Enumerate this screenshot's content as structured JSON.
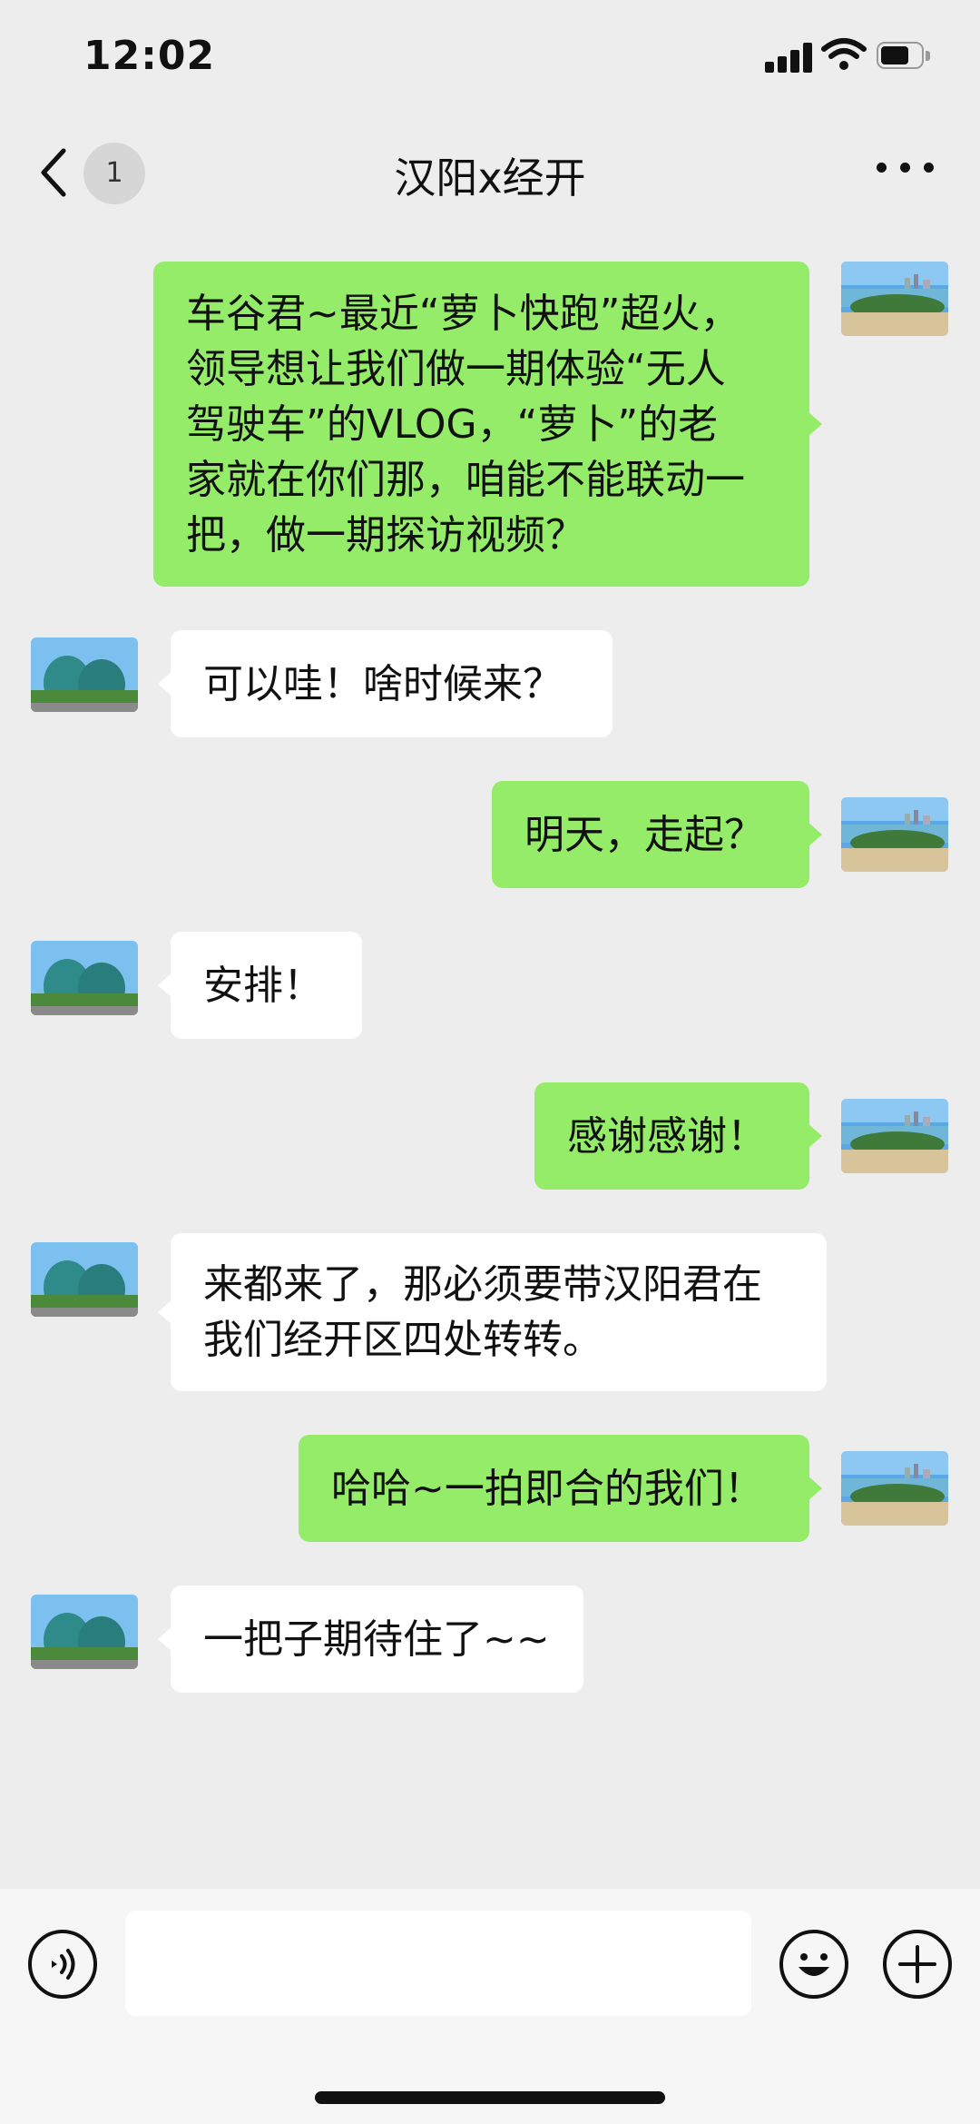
{
  "status_bar": {
    "time": "12:02"
  },
  "header": {
    "unread_count": "1",
    "title": "汉阳x经开"
  },
  "messages": [
    {
      "side": "out",
      "text": "车谷君~最近“萝卜快跑”超火，\n领导想让我们做一期体验“无人\n驾驶车”的VLOG，“萝卜”的老\n家就在你们那，咱能不能联动一\n把，做一期探访视频？"
    },
    {
      "side": "in",
      "text": "可以哇！啥时候来？"
    },
    {
      "side": "out",
      "text": "明天，走起？"
    },
    {
      "side": "in",
      "text": "安排！"
    },
    {
      "side": "out",
      "text": "感谢感谢！"
    },
    {
      "side": "in",
      "text": "来都来了，那必须要带汉阳君在\n我们经开区四处转转。"
    },
    {
      "side": "out",
      "text": "哈哈~一拍即合的我们！"
    },
    {
      "side": "in",
      "text": "一把子期待住了~~"
    }
  ],
  "input_bar": {
    "text_value": ""
  },
  "icons": {
    "back": "chevron-left-icon",
    "more": "more-dots-icon",
    "voice": "voice-icon",
    "emoji": "emoji-icon",
    "plus": "plus-icon"
  },
  "colors": {
    "background": "#ededed",
    "outgoing_bubble": "#95ec69",
    "incoming_bubble": "#ffffff",
    "input_bar": "#f6f6f6"
  }
}
